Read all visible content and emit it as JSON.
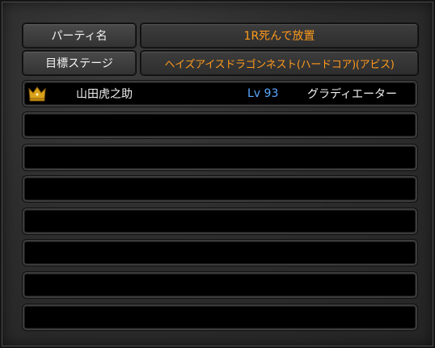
{
  "party": {
    "name_label": "パーティ名",
    "name_value": "1R死んで放置",
    "stage_label": "目標ステージ",
    "stage_value": "ヘイズアイスドラゴンネスト(ハードコア)(アビス)"
  },
  "members": [
    {
      "name": "山田虎之助",
      "level": "Lv 93",
      "class": "グラディエーター",
      "is_leader": true
    },
    {
      "name": "",
      "level": "",
      "class": ""
    },
    {
      "name": "",
      "level": "",
      "class": ""
    },
    {
      "name": "",
      "level": "",
      "class": ""
    },
    {
      "name": "",
      "level": "",
      "class": ""
    },
    {
      "name": "",
      "level": "",
      "class": ""
    },
    {
      "name": "",
      "level": "",
      "class": ""
    },
    {
      "name": "",
      "level": "",
      "class": ""
    }
  ],
  "colors": {
    "accent_orange": "#ff9a1c",
    "level_blue": "#5aa8ff",
    "text_white": "#f2f2f2"
  },
  "icons": {
    "leader": "crown-icon"
  }
}
